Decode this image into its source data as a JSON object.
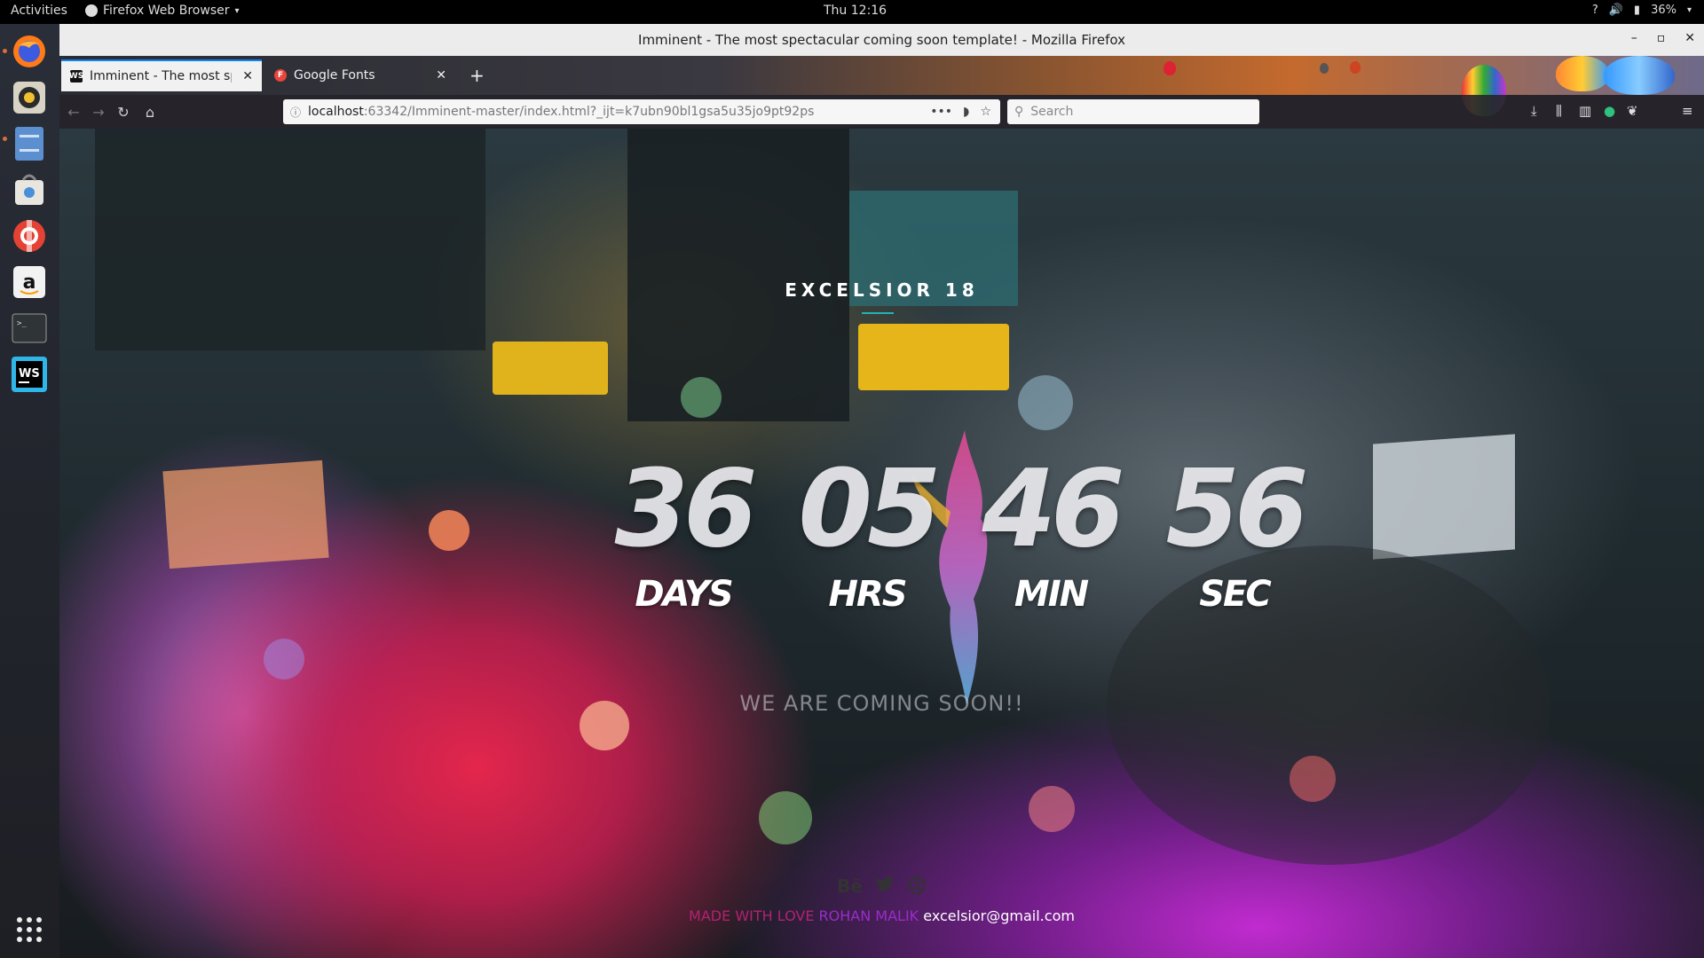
{
  "system_bar": {
    "activities": "Activities",
    "app_name": "Firefox Web Browser",
    "clock": "Thu 12:16",
    "battery": "36%"
  },
  "dock": {
    "items": [
      "firefox-icon",
      "rhythmbox-icon",
      "files-icon",
      "software-icon",
      "help-icon",
      "amazon-icon",
      "terminal-icon",
      "webstorm-icon",
      "show-apps-icon"
    ]
  },
  "window": {
    "title": "Imminent - The most spectacular coming soon template! - Mozilla Firefox"
  },
  "tabs": [
    {
      "label": "Imminent - The most spe",
      "favicon": "WS"
    },
    {
      "label": "Google Fonts",
      "favicon": "F"
    }
  ],
  "navbar": {
    "url_host": "localhost",
    "url_path": ":63342/Imminent-master/index.html?_ijt=k7ubn90bl1gsa5u35jo9pt92ps",
    "search_placeholder": "Search"
  },
  "page": {
    "brand": "EXCELSIOR 18",
    "countdown": [
      {
        "value": "36",
        "label": "DAYS"
      },
      {
        "value": "05",
        "label": "HRS"
      },
      {
        "value": "46",
        "label": "MIN"
      },
      {
        "value": "56",
        "label": "SEC"
      }
    ],
    "tagline": "WE ARE COMING SOON!!",
    "social": [
      "Bē",
      "twitter-icon",
      "dribbble-icon"
    ],
    "credits": {
      "made": "MADE WITH LOVE ",
      "author": "ROHAN MALIK",
      "email": " excelsior@gmail.com"
    }
  },
  "colors": {
    "accent": "#1fb5b5",
    "active_tab_accent": "#0a84ff"
  }
}
